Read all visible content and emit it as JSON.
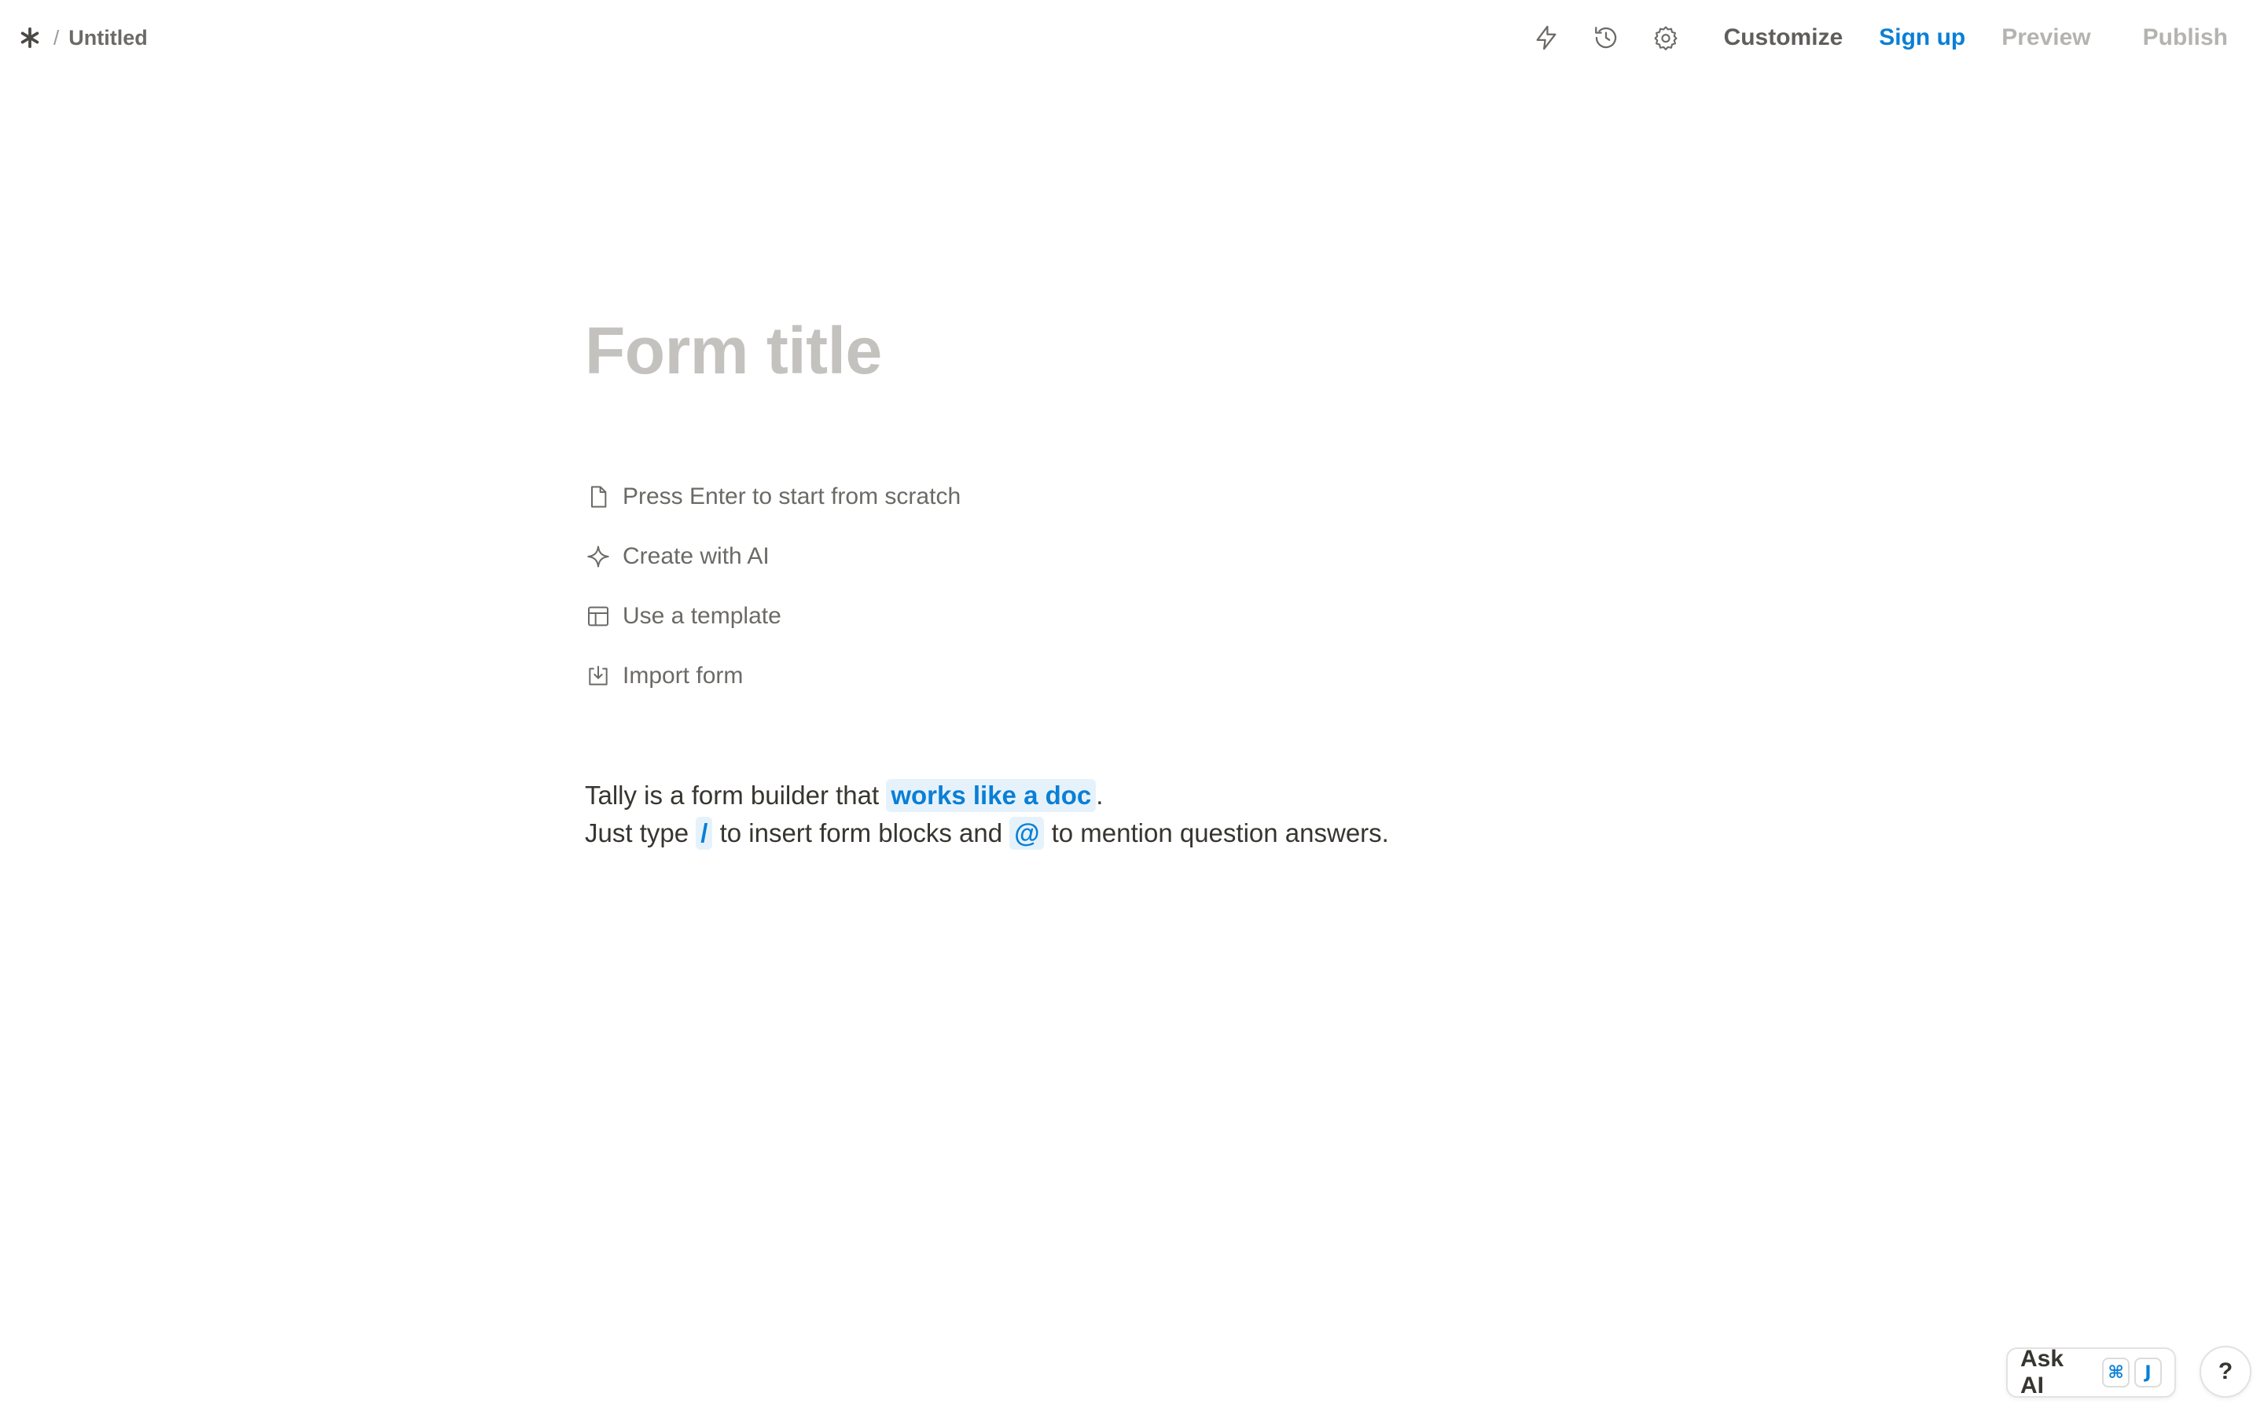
{
  "breadcrumb": {
    "separator": "/",
    "title": "Untitled"
  },
  "toolbar": {
    "icons": [
      "lightning-icon",
      "history-icon",
      "gear-icon"
    ],
    "customize_label": "Customize",
    "signup_label": "Sign up",
    "preview_label": "Preview",
    "publish_label": "Publish"
  },
  "editor": {
    "title_placeholder": "Form title",
    "options": [
      {
        "icon": "document-icon",
        "label": "Press Enter to start from scratch"
      },
      {
        "icon": "sparkle-icon",
        "label": "Create with AI"
      },
      {
        "icon": "template-icon",
        "label": "Use a template"
      },
      {
        "icon": "import-icon",
        "label": "Import form"
      }
    ],
    "intro": {
      "line1_prefix": "Tally is a form builder that ",
      "line1_highlight": "works like a doc",
      "line1_suffix": ".",
      "line2_prefix": "Just type ",
      "line2_slash": "/",
      "line2_middle": " to insert form blocks and ",
      "line2_at": "@",
      "line2_suffix": " to mention question answers."
    }
  },
  "ask_ai": {
    "label": "Ask AI",
    "key1": "⌘",
    "key2": "J"
  },
  "help": {
    "label": "?"
  },
  "colors": {
    "accent": "#0a7fd6",
    "highlight_bg": "#e6f2fb",
    "placeholder": "#c3c2bf"
  }
}
